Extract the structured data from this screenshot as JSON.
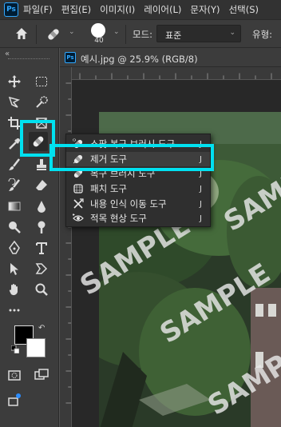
{
  "app": {
    "logo": "Ps"
  },
  "menu": [
    "파일(F)",
    "편집(E)",
    "이미지(I)",
    "레이어(L)",
    "문자(Y)",
    "선택(S)"
  ],
  "options_bar": {
    "brush_size": "40",
    "mode_label": "모드:",
    "mode_value": "표준",
    "type_label": "유형:"
  },
  "document_tab": {
    "icon": "Ps",
    "title": "예시.jpg @ 25.9% (RGB/8)"
  },
  "flyout": {
    "items": [
      {
        "label": "스팟 복구 브러시 도구",
        "key": "J",
        "icon": "spot-healing-brush-icon"
      },
      {
        "label": "제거 도구",
        "key": "J",
        "icon": "remove-tool-icon",
        "selected": true
      },
      {
        "label": "복구 브러시 도구",
        "key": "J",
        "icon": "healing-brush-icon"
      },
      {
        "label": "패치 도구",
        "key": "J",
        "icon": "patch-icon"
      },
      {
        "label": "내용 인식 이동 도구",
        "key": "J",
        "icon": "content-aware-move-icon"
      },
      {
        "label": "적목 현상 도구",
        "key": "J",
        "icon": "red-eye-icon"
      }
    ]
  },
  "watermark": "SAMPLE",
  "colors": {
    "highlight": "#00e1f0",
    "fg": "#000000",
    "bg": "#ffffff"
  }
}
